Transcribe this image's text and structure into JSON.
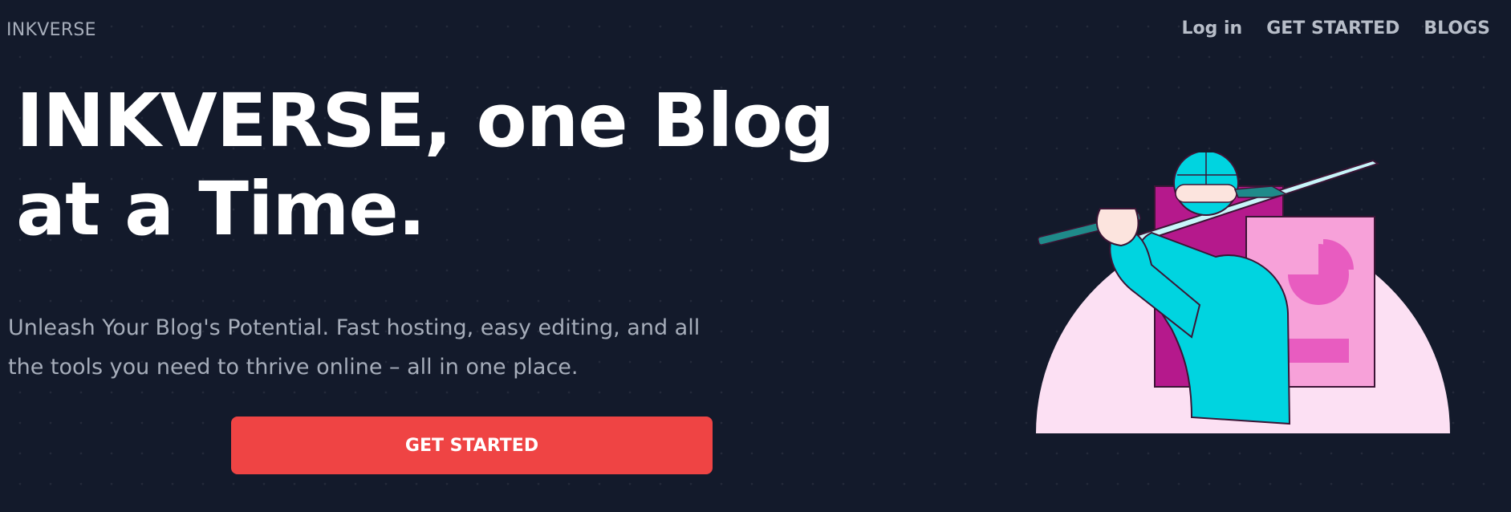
{
  "header": {
    "brand": "INKVERSE",
    "nav": {
      "login": "Log in",
      "get_started": "GET STARTED",
      "blogs": "BLOGS"
    }
  },
  "hero": {
    "headline": "INKVERSE, one Blog at a Time.",
    "subtext": "Unleash Your Blog's Potential. Fast hosting, easy editing, and all the tools you need to thrive online – all in one place.",
    "cta_label": "GET STARTED",
    "illustration": "ninja-blogger-illustration"
  },
  "colors": {
    "background": "#131a2b",
    "accent": "#ef4444",
    "muted_text": "#a6adba",
    "illustration_cyan": "#00d4e0",
    "illustration_magenta": "#b5198c",
    "illustration_pink": "#f7a1d9"
  }
}
